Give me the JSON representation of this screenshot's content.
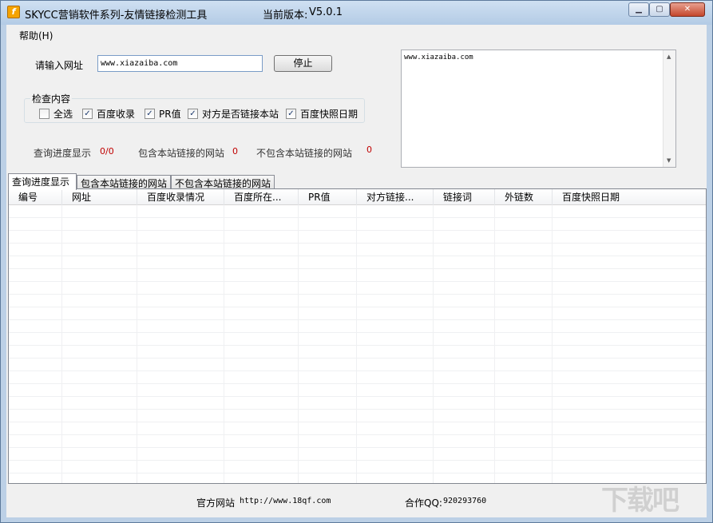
{
  "window": {
    "title": "SKYCC营销软件系列-友情链接检测工具",
    "version_label": "当前版本:",
    "version_value": "V5.0.1",
    "controls": {
      "minimize": "▁",
      "maximize": "▢",
      "close": "✕"
    },
    "icon": "f"
  },
  "menu": {
    "help": "帮助(H)"
  },
  "form": {
    "url_label": "请输入网址",
    "url_value": "www.xiazaiba.com",
    "stop_button": "停止",
    "url_list_text": "www.xiazaiba.com"
  },
  "check_group": {
    "title": "检查内容",
    "items": [
      {
        "label": "全选",
        "checked": false,
        "mark": ""
      },
      {
        "label": "百度收录",
        "checked": true,
        "mark": "✓"
      },
      {
        "label": "PR值",
        "checked": true,
        "mark": "✓"
      },
      {
        "label": "对方是否链接本站",
        "checked": true,
        "mark": "✓"
      },
      {
        "label": "百度快照日期",
        "checked": true,
        "mark": "✓"
      }
    ]
  },
  "progress": {
    "query_label": "查询进度显示",
    "query_value": "0/0",
    "included_label": "包含本站链接的网站",
    "included_value": "0",
    "excluded_label": "不包含本站链接的网站",
    "excluded_value": "0"
  },
  "tabs": [
    {
      "label": "查询进度显示",
      "active": true
    },
    {
      "label": "包含本站链接的网站",
      "active": false
    },
    {
      "label": "不包含本站链接的网站",
      "active": false
    }
  ],
  "table": {
    "columns": [
      "编号",
      "网址",
      "百度收录情况",
      "百度所在...",
      "PR值",
      "对方链接...",
      "链接词",
      "外链数",
      "百度快照日期"
    ]
  },
  "status": {
    "website_label": "官方网站",
    "website_url": "http://www.18qf.com",
    "qq_label": "合作QQ:",
    "qq_value": "920293760"
  },
  "watermark": "下载吧",
  "colors": {
    "title_bar": "#bcd0e6",
    "progress_value": "#c00000",
    "close_button": "#c4472c"
  }
}
